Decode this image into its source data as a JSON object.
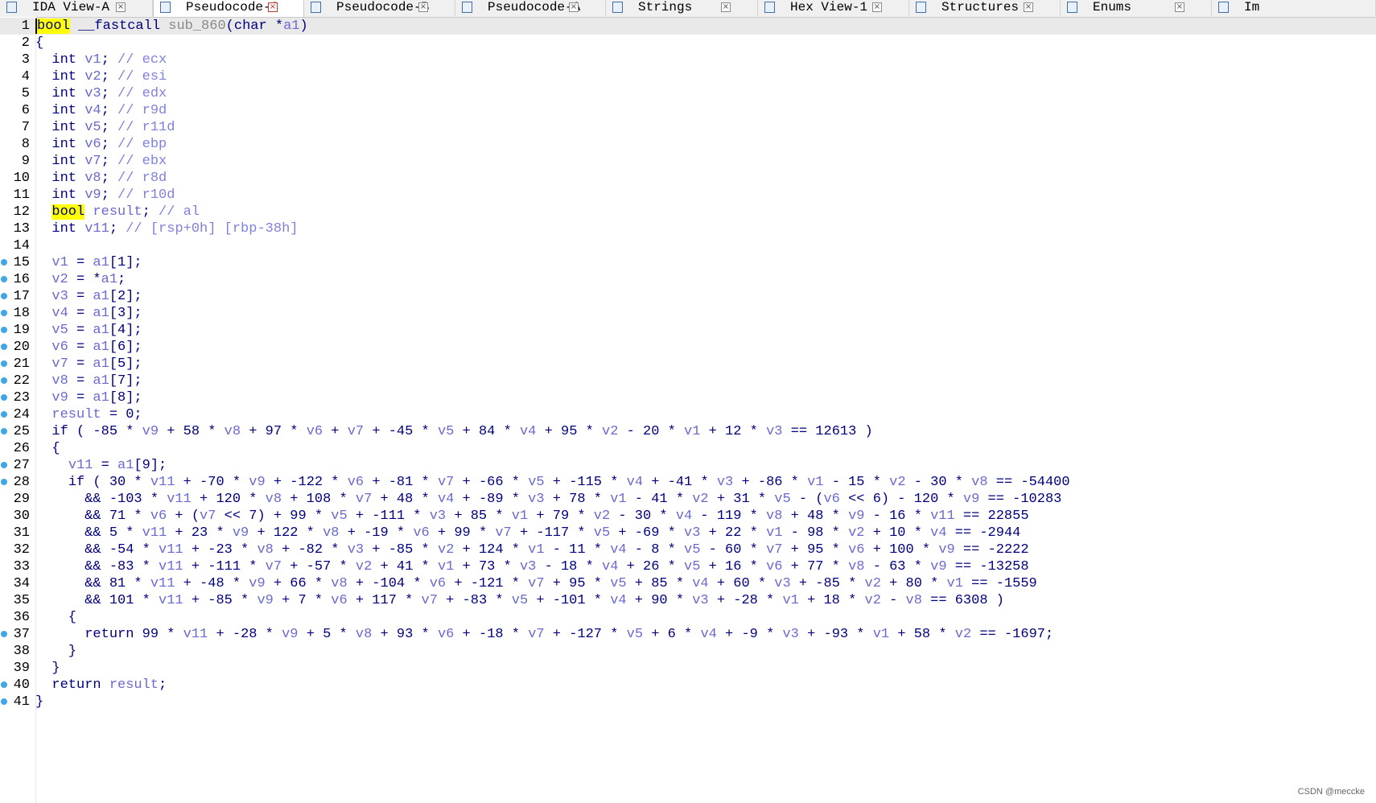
{
  "tabs": [
    {
      "label": "IDA View-A",
      "icon": "disassembly-view-icon",
      "active": false
    },
    {
      "label": "Pseudocode-C",
      "icon": "pseudocode-icon",
      "active": true
    },
    {
      "label": "Pseudocode-B",
      "icon": "pseudocode-icon",
      "active": false
    },
    {
      "label": "Pseudocode-A",
      "icon": "pseudocode-icon",
      "active": false
    },
    {
      "label": "Strings",
      "icon": "strings-icon",
      "active": false
    },
    {
      "label": "Hex View-1",
      "icon": "hex-view-icon",
      "active": false
    },
    {
      "label": "Structures",
      "icon": "structures-icon",
      "active": false
    },
    {
      "label": "Enums",
      "icon": "enums-icon",
      "active": false
    },
    {
      "label": "Im",
      "icon": "imports-icon",
      "active": false
    }
  ],
  "current_line": 1,
  "lines": [
    {
      "n": "1",
      "bp": false,
      "t": "bool __fastcall sub_860(char *a1)"
    },
    {
      "n": "2",
      "bp": false,
      "t": "{"
    },
    {
      "n": "3",
      "bp": false,
      "t": "  int v1; // ecx"
    },
    {
      "n": "4",
      "bp": false,
      "t": "  int v2; // esi"
    },
    {
      "n": "5",
      "bp": false,
      "t": "  int v3; // edx"
    },
    {
      "n": "6",
      "bp": false,
      "t": "  int v4; // r9d"
    },
    {
      "n": "7",
      "bp": false,
      "t": "  int v5; // r11d"
    },
    {
      "n": "8",
      "bp": false,
      "t": "  int v6; // ebp"
    },
    {
      "n": "9",
      "bp": false,
      "t": "  int v7; // ebx"
    },
    {
      "n": "10",
      "bp": false,
      "t": "  int v8; // r8d"
    },
    {
      "n": "11",
      "bp": false,
      "t": "  int v9; // r10d"
    },
    {
      "n": "12",
      "bp": false,
      "t": "  bool result; // al"
    },
    {
      "n": "13",
      "bp": false,
      "t": "  int v11; // [rsp+0h] [rbp-38h]"
    },
    {
      "n": "14",
      "bp": false,
      "t": ""
    },
    {
      "n": "15",
      "bp": true,
      "t": "  v1 = a1[1];"
    },
    {
      "n": "16",
      "bp": true,
      "t": "  v2 = *a1;"
    },
    {
      "n": "17",
      "bp": true,
      "t": "  v3 = a1[2];"
    },
    {
      "n": "18",
      "bp": true,
      "t": "  v4 = a1[3];"
    },
    {
      "n": "19",
      "bp": true,
      "t": "  v5 = a1[4];"
    },
    {
      "n": "20",
      "bp": true,
      "t": "  v6 = a1[6];"
    },
    {
      "n": "21",
      "bp": true,
      "t": "  v7 = a1[5];"
    },
    {
      "n": "22",
      "bp": true,
      "t": "  v8 = a1[7];"
    },
    {
      "n": "23",
      "bp": true,
      "t": "  v9 = a1[8];"
    },
    {
      "n": "24",
      "bp": true,
      "t": "  result = 0;"
    },
    {
      "n": "25",
      "bp": true,
      "t": "  if ( -85 * v9 + 58 * v8 + 97 * v6 + v7 + -45 * v5 + 84 * v4 + 95 * v2 - 20 * v1 + 12 * v3 == 12613 )"
    },
    {
      "n": "26",
      "bp": false,
      "t": "  {"
    },
    {
      "n": "27",
      "bp": true,
      "t": "    v11 = a1[9];"
    },
    {
      "n": "28",
      "bp": true,
      "t": "    if ( 30 * v11 + -70 * v9 + -122 * v6 + -81 * v7 + -66 * v5 + -115 * v4 + -41 * v3 + -86 * v1 - 15 * v2 - 30 * v8 == -54400"
    },
    {
      "n": "29",
      "bp": false,
      "t": "      && -103 * v11 + 120 * v8 + 108 * v7 + 48 * v4 + -89 * v3 + 78 * v1 - 41 * v2 + 31 * v5 - (v6 << 6) - 120 * v9 == -10283"
    },
    {
      "n": "30",
      "bp": false,
      "t": "      && 71 * v6 + (v7 << 7) + 99 * v5 + -111 * v3 + 85 * v1 + 79 * v2 - 30 * v4 - 119 * v8 + 48 * v9 - 16 * v11 == 22855"
    },
    {
      "n": "31",
      "bp": false,
      "t": "      && 5 * v11 + 23 * v9 + 122 * v8 + -19 * v6 + 99 * v7 + -117 * v5 + -69 * v3 + 22 * v1 - 98 * v2 + 10 * v4 == -2944"
    },
    {
      "n": "32",
      "bp": false,
      "t": "      && -54 * v11 + -23 * v8 + -82 * v3 + -85 * v2 + 124 * v1 - 11 * v4 - 8 * v5 - 60 * v7 + 95 * v6 + 100 * v9 == -2222"
    },
    {
      "n": "33",
      "bp": false,
      "t": "      && -83 * v11 + -111 * v7 + -57 * v2 + 41 * v1 + 73 * v3 - 18 * v4 + 26 * v5 + 16 * v6 + 77 * v8 - 63 * v9 == -13258"
    },
    {
      "n": "34",
      "bp": false,
      "t": "      && 81 * v11 + -48 * v9 + 66 * v8 + -104 * v6 + -121 * v7 + 95 * v5 + 85 * v4 + 60 * v3 + -85 * v2 + 80 * v1 == -1559"
    },
    {
      "n": "35",
      "bp": false,
      "t": "      && 101 * v11 + -85 * v9 + 7 * v6 + 117 * v7 + -83 * v5 + -101 * v4 + 90 * v3 + -28 * v1 + 18 * v2 - v8 == 6308 )"
    },
    {
      "n": "36",
      "bp": false,
      "t": "    {"
    },
    {
      "n": "37",
      "bp": true,
      "t": "      return 99 * v11 + -28 * v9 + 5 * v8 + 93 * v6 + -18 * v7 + -127 * v5 + 6 * v4 + -9 * v3 + -93 * v1 + 58 * v2 == -1697;"
    },
    {
      "n": "38",
      "bp": false,
      "t": "    }"
    },
    {
      "n": "39",
      "bp": false,
      "t": "  }"
    },
    {
      "n": "40",
      "bp": true,
      "t": "  return result;"
    },
    {
      "n": "41",
      "bp": true,
      "t": "}"
    }
  ],
  "watermark": "CSDN @meccke",
  "colors": {
    "keyword": "#000080",
    "variable": "#6a6ad2",
    "comment": "#8080e0",
    "highlight": "#ffff00",
    "breakpoint": "#41a6e8"
  }
}
